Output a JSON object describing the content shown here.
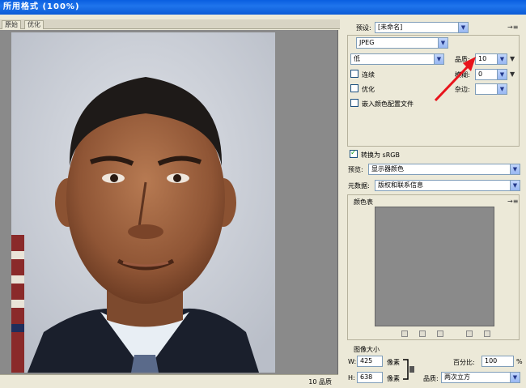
{
  "window": {
    "title": "所用格式 (100%)"
  },
  "tabs": [
    {
      "label": "原始"
    },
    {
      "label": "优化"
    }
  ],
  "status": {
    "quality": "10 品质"
  },
  "settings": {
    "preset_label": "预设:",
    "preset_value": "[未命名]",
    "format_value": "JPEG",
    "compression_value": "低",
    "quality_label": "品质:",
    "quality_value": "10",
    "progressive_label": "连续",
    "blur_label": "模糊:",
    "blur_value": "0",
    "optimized_label": "优化",
    "matte_label": "杂边:",
    "matte_value": "",
    "embed_profile_label": "嵌入颜色配置文件"
  },
  "color": {
    "convert_srgb_label": "转换为 sRGB",
    "convert_srgb_checked": true,
    "preview_label": "预览:",
    "preview_value": "显示器颜色",
    "metadata_label": "元数据:",
    "metadata_value": "版权和联系信息"
  },
  "colortable": {
    "title": "颜色表"
  },
  "image_size": {
    "title": "图像大小",
    "w_label": "W:",
    "w_value": "425",
    "h_label": "H:",
    "h_value": "638",
    "unit": "像素",
    "percent_label": "百分比:",
    "percent_value": "100",
    "percent_unit": "%",
    "quality_label": "品质:",
    "quality_value": "两次立方"
  },
  "colors": {
    "annotation_arrow": "#e8141c",
    "title_bar": "#0a5fe0"
  }
}
